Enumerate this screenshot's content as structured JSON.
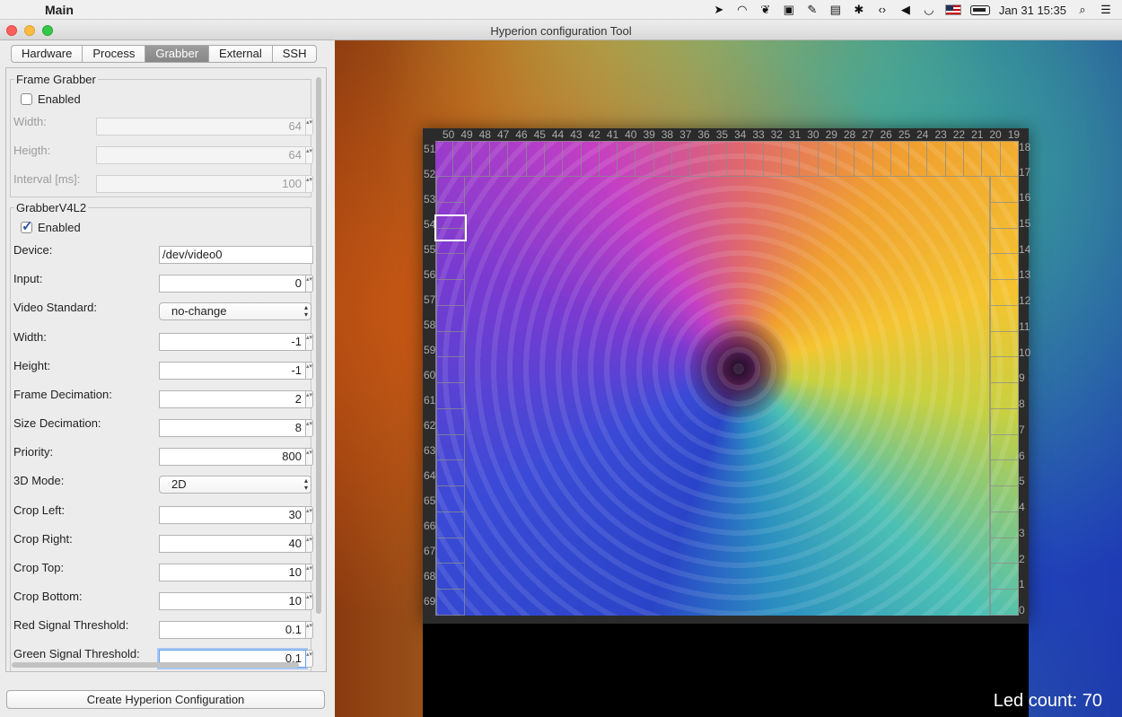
{
  "menubar": {
    "app_name": "Main",
    "clock": "Jan 31  15:35"
  },
  "window": {
    "title": "Hyperion configuration Tool"
  },
  "tabs": [
    "Hardware",
    "Process",
    "Grabber",
    "External",
    "SSH"
  ],
  "active_tab": "Grabber",
  "frame_grabber": {
    "title": "Frame Grabber",
    "enabled_label": "Enabled",
    "enabled": false,
    "width_label": "Width:",
    "width_value": "64",
    "height_label": "Heigth:",
    "height_value": "64",
    "interval_label": "Interval [ms]:",
    "interval_value": "100"
  },
  "grabber_v4l2": {
    "title": "GrabberV4L2",
    "enabled_label": "Enabled",
    "enabled": true,
    "device_label": "Device:",
    "device_value": "/dev/video0",
    "input_label": "Input:",
    "input_value": "0",
    "video_standard_label": "Video Standard:",
    "video_standard_value": "no-change",
    "width_label": "Width:",
    "width_value": "-1",
    "height_label": "Height:",
    "height_value": "-1",
    "frame_decimation_label": "Frame Decimation:",
    "frame_decimation_value": "2",
    "size_decimation_label": "Size Decimation:",
    "size_decimation_value": "8",
    "priority_label": "Priority:",
    "priority_value": "800",
    "mode3d_label": "3D Mode:",
    "mode3d_value": "2D",
    "crop_left_label": "Crop Left:",
    "crop_left_value": "30",
    "crop_right_label": "Crop Right:",
    "crop_right_value": "40",
    "crop_top_label": "Crop Top:",
    "crop_top_value": "10",
    "crop_bottom_label": "Crop Bottom:",
    "crop_bottom_value": "10",
    "red_threshold_label": "Red Signal Threshold:",
    "red_threshold_value": "0.1",
    "green_threshold_label": "Green Signal Threshold:",
    "green_threshold_value": "0.1"
  },
  "create_button": "Create Hyperion Configuration",
  "preview": {
    "top_numbers": [
      "50",
      "49",
      "48",
      "47",
      "46",
      "45",
      "44",
      "43",
      "42",
      "41",
      "40",
      "39",
      "38",
      "37",
      "36",
      "35",
      "34",
      "33",
      "32",
      "31",
      "30",
      "29",
      "28",
      "27",
      "26",
      "25",
      "24",
      "23",
      "22",
      "21",
      "20",
      "19"
    ],
    "right_corner_top": [
      "18",
      "17"
    ],
    "left_numbers": [
      "51",
      "52",
      "53",
      "54",
      "55",
      "56",
      "57",
      "58",
      "59",
      "60",
      "61",
      "62",
      "63",
      "64",
      "65",
      "66",
      "67",
      "68",
      "69"
    ],
    "right_numbers": [
      "16",
      "15",
      "14",
      "13",
      "12",
      "11",
      "10",
      "9",
      "8",
      "7",
      "6",
      "5",
      "4",
      "3",
      "2",
      "1",
      "0"
    ],
    "led_count": "Led count: 70"
  }
}
